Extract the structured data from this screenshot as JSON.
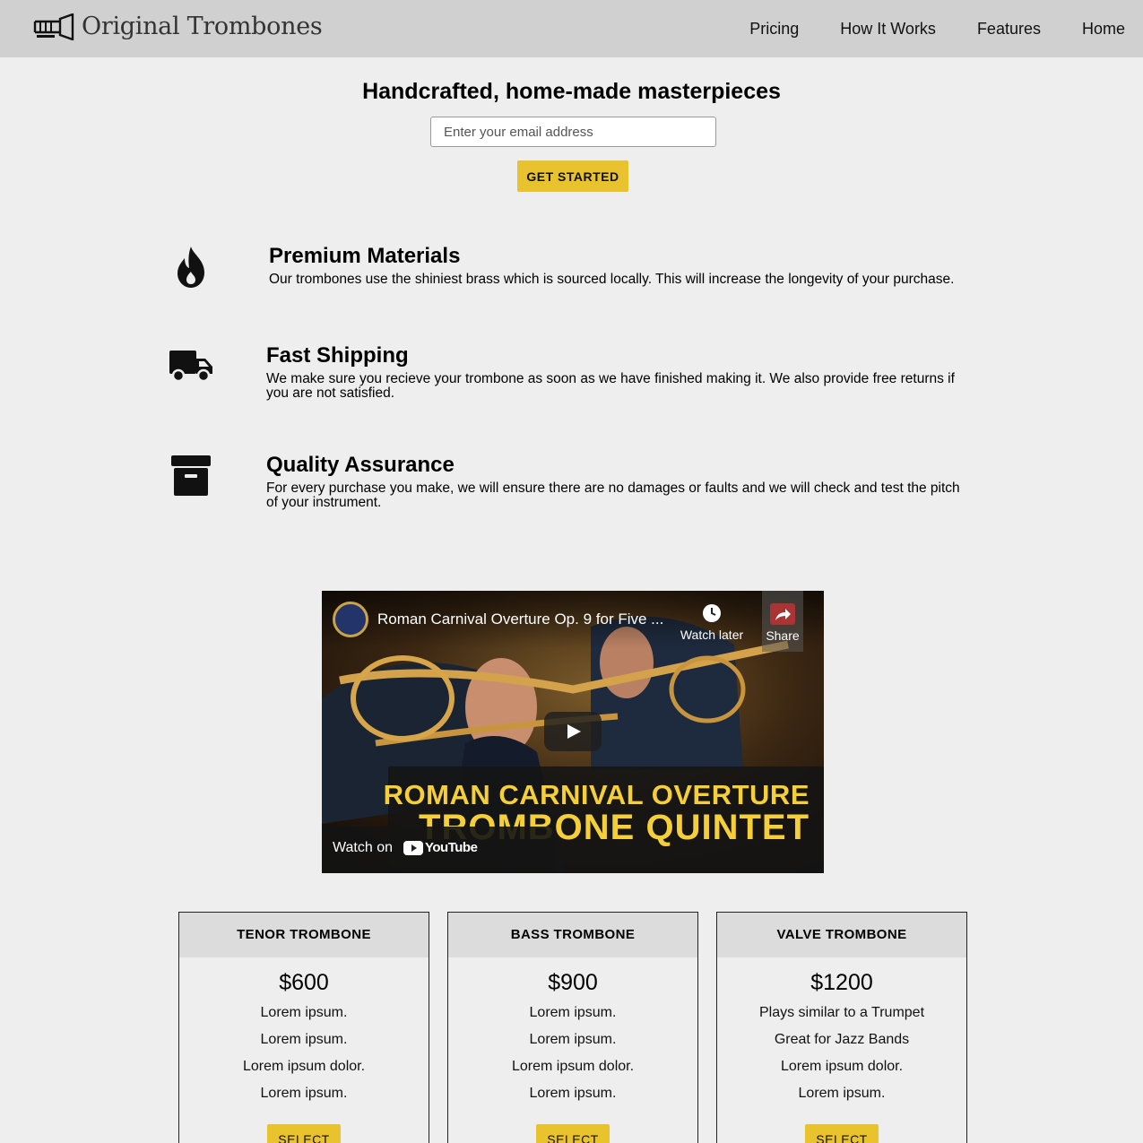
{
  "header": {
    "brand": "Original Trombones",
    "nav": [
      "Pricing",
      "How It Works",
      "Features",
      "Home"
    ]
  },
  "hero": {
    "title": "Handcrafted, home-made masterpieces",
    "email_placeholder": "Enter your email address",
    "cta_label": "GET STARTED"
  },
  "features": [
    {
      "icon": "fire-icon",
      "title": "Premium Materials",
      "text": "Our trombones use the shiniest brass which is sourced locally. This will increase the longevity of your purchase."
    },
    {
      "icon": "truck-icon",
      "title": "Fast Shipping",
      "text": "We make sure you recieve your trombone as soon as we have finished making it. We also provide free returns if you are not satisfied."
    },
    {
      "icon": "archive-box-icon",
      "title": "Quality Assurance",
      "text": "For every purchase you make, we will ensure there are no damages or faults and we will check and test the pitch of your instrument."
    }
  ],
  "video": {
    "title": "Roman Carnival Overture Op. 9 for Five ...",
    "watch_later": "Watch later",
    "share": "Share",
    "banner_line1": "ROMAN CARNIVAL OVERTURE",
    "banner_line2": "TROMBONE QUINTET",
    "watch_on": "Watch on",
    "platform": "YouTube"
  },
  "pricing": [
    {
      "name": "TENOR TROMBONE",
      "price": "$600",
      "features": [
        "Lorem ipsum.",
        "Lorem ipsum.",
        "Lorem ipsum dolor.",
        "Lorem ipsum."
      ],
      "button": "SELECT"
    },
    {
      "name": "BASS TROMBONE",
      "price": "$900",
      "features": [
        "Lorem ipsum.",
        "Lorem ipsum.",
        "Lorem ipsum dolor.",
        "Lorem ipsum."
      ],
      "button": "SELECT"
    },
    {
      "name": "VALVE TROMBONE",
      "price": "$1200",
      "features": [
        "Plays similar to a Trumpet",
        "Great for Jazz Bands",
        "Lorem ipsum dolor.",
        "Lorem ipsum."
      ],
      "button": "SELECT"
    }
  ],
  "colors": {
    "accent": "#e8c32e",
    "background": "#eeeeee",
    "header": "#d0d0d0",
    "banner_text": "#f4cf3a"
  }
}
